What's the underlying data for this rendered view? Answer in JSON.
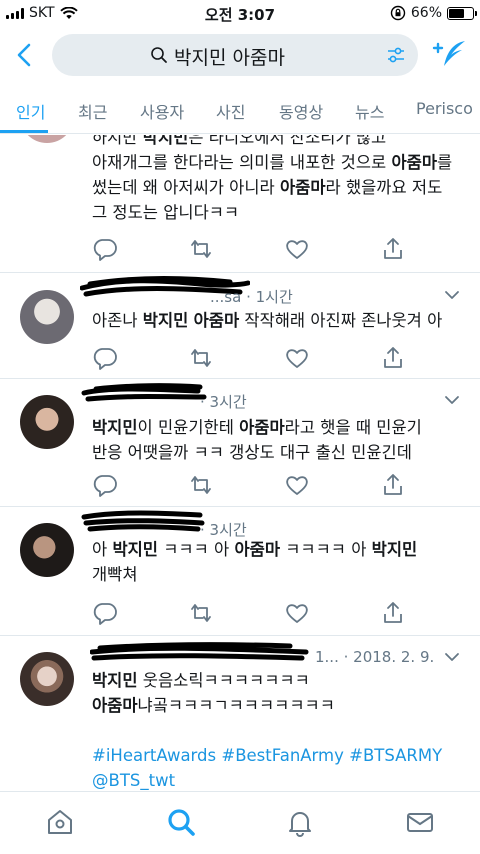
{
  "status_bar": {
    "carrier": "SKT",
    "time": "오전 3:07",
    "battery_percent": "66%",
    "battery_level": 0.66,
    "icons": [
      "signal-icon",
      "wifi-icon",
      "orientation-lock-icon",
      "battery-icon"
    ]
  },
  "search": {
    "query": "박지민 아줌마",
    "icons": [
      "back-arrow-icon",
      "search-icon",
      "filter-sliders-icon",
      "compose-tweet-icon"
    ]
  },
  "tabs": [
    {
      "label": "인기",
      "active": true
    },
    {
      "label": "최근",
      "active": false
    },
    {
      "label": "사용자",
      "active": false
    },
    {
      "label": "사진",
      "active": false
    },
    {
      "label": "동영상",
      "active": false
    },
    {
      "label": "뉴스",
      "active": false
    },
    {
      "label": "Perisco",
      "active": false
    }
  ],
  "tweets": [
    {
      "name": "",
      "handle": "",
      "time": "",
      "body_lines": [
        [
          {
            "t": "하시만 "
          },
          {
            "t": "박지민",
            "b": true
          },
          {
            "t": "은 라디오에서 잔소리가 많고"
          }
        ],
        [
          {
            "t": "아재개그를 한다라는 의미를 내포한 것으로 "
          },
          {
            "t": "아줌마",
            "b": true
          },
          {
            "t": "를"
          }
        ],
        [
          {
            "t": "썼는데 왜 아저씨가 아니라 "
          },
          {
            "t": "아줌마",
            "b": true
          },
          {
            "t": "라 했을까요 저도"
          }
        ],
        [
          {
            "t": "그 정도는 압니다ㅋㅋ"
          }
        ]
      ]
    },
    {
      "name": "",
      "handle": "...sa",
      "time": "1시간",
      "body_lines": [
        [
          {
            "t": "아존나 "
          },
          {
            "t": "박지민",
            "b": true
          },
          {
            "t": " "
          },
          {
            "t": "아줌마",
            "b": true
          },
          {
            "t": " 작작해래 아진짜 존나웃겨 아"
          }
        ]
      ]
    },
    {
      "name": "",
      "handle": "",
      "time": "3시간",
      "body_lines": [
        [
          {
            "t": "박지민",
            "b": true
          },
          {
            "t": "이 민윤기한테 "
          },
          {
            "t": "아줌마",
            "b": true
          },
          {
            "t": "라고 햇을 때 민윤기"
          }
        ],
        [
          {
            "t": "반응 어땟을까 ㅋㅋ 갱상도 대구 출신 민윤긴데"
          }
        ]
      ]
    },
    {
      "name": "",
      "handle": "",
      "time": "3시간",
      "body_lines": [
        [
          {
            "t": "아 "
          },
          {
            "t": "박지민",
            "b": true
          },
          {
            "t": " ㅋㅋㅋ 아 "
          },
          {
            "t": "아줌마",
            "b": true
          },
          {
            "t": " ㅋㅋㅋㅋ 아 "
          },
          {
            "t": "박지민",
            "b": true
          }
        ],
        [
          {
            "t": "개빡쳐"
          }
        ]
      ]
    },
    {
      "name": "",
      "handle": "1...",
      "time": "2018. 2. 9.",
      "body_lines": [
        [
          {
            "t": "박지민",
            "b": true
          },
          {
            "t": " 웃음소릭ㅋㅋㅋㅋㅋㅋㅋ"
          }
        ],
        [
          {
            "t": "아줌마",
            "b": true
          },
          {
            "t": "냐곸ㅋㅋㅋㄱㅋㅋㅋㅋㅋㅋㅋ"
          }
        ],
        [
          {
            "t": ""
          }
        ],
        [
          {
            "t": "#iHeartAwards #BestFanArmy #BTSARMY",
            "link": true
          }
        ],
        [
          {
            "t": "@BTS_twt",
            "link": true
          }
        ]
      ]
    }
  ],
  "tweet_actions": [
    "reply-icon",
    "retweet-icon",
    "like-icon",
    "share-icon"
  ],
  "bottom_nav": [
    "home-icon",
    "search-icon",
    "notifications-icon",
    "messages-icon"
  ],
  "colors": {
    "accent": "#1da1f2",
    "link": "#1b95e0",
    "secondary_text": "#657786",
    "search_bg": "#e6ecf0",
    "divider": "#e1e8ed"
  }
}
